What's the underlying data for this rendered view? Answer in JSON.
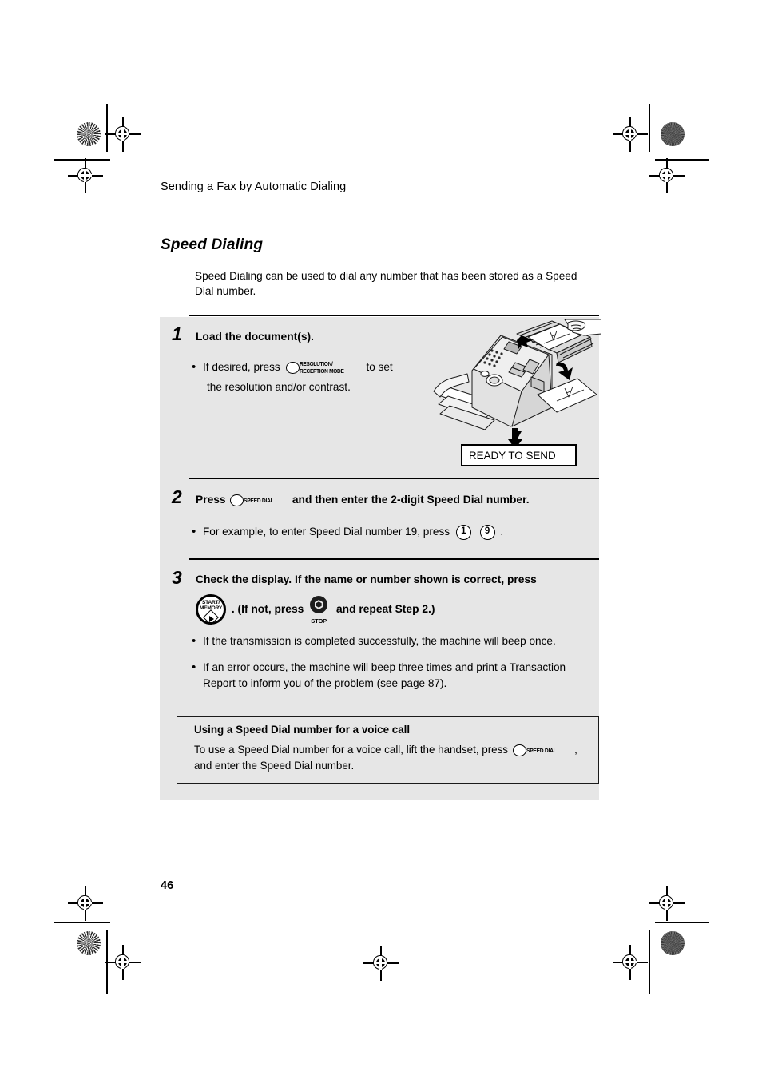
{
  "page": {
    "running_head": "Sending a Fax by Automatic Dialing",
    "section_title": "Speed Dialing",
    "intro": "Speed Dialing can be used to dial any number that has been stored as a Speed Dial number.",
    "page_number": "46",
    "panel_bg": "#e6e6e6",
    "text_color": "#000000"
  },
  "steps": [
    {
      "number": "1",
      "heading": "Load the document(s).",
      "bullet_pre": "If desired, press",
      "button_line1": "RESOLUTION/",
      "button_line2": "RECEPTION MODE",
      "bullet_post": "to set",
      "bullet_second_line": "the resolution and/or contrast."
    },
    {
      "number": "2",
      "heading_pre": "Press",
      "button_label": "SPEED DIAL",
      "heading_post": "and then enter the 2-digit Speed Dial number.",
      "bullet_pre": "For example, to enter Speed Dial number 19, press",
      "key1": "1",
      "key2": "9",
      "bullet_post": "."
    },
    {
      "number": "3",
      "heading": "Check the display. If the name or number shown is correct, press",
      "start_button_line1": "START/",
      "start_button_line2": "MEMORY",
      "mid_text": ". (If not, press",
      "stop_button_label": "STOP",
      "end_text": "and repeat Step 2.)",
      "bullets": [
        "If the transmission is completed successfully, the machine will beep once.",
        "If an error occurs, the machine will beep three times and print a Transaction Report to inform you of the problem (see page 87)."
      ]
    }
  ],
  "display": {
    "readout": "READY TO SEND"
  },
  "note": {
    "title": "Using a Speed Dial number for a voice call",
    "text_pre": "To use a Speed Dial number for a voice call, lift the handset, press",
    "button_label": "SPEED DIAL",
    "text_post": ",",
    "text_second_line": "and enter the Speed Dial number."
  },
  "illustration": {
    "name": "fax-machine-loading-documents"
  }
}
